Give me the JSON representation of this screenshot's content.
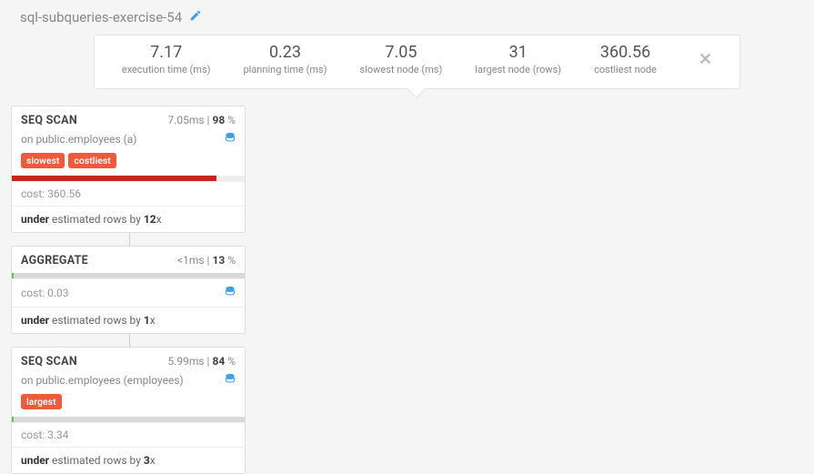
{
  "title": "sql-subqueries-exercise-54",
  "stats": {
    "execution": {
      "value": "7.17",
      "label": "execution time (ms)"
    },
    "planning": {
      "value": "0.23",
      "label": "planning time (ms)"
    },
    "slowest": {
      "value": "7.05",
      "label": "slowest node (ms)"
    },
    "largest": {
      "value": "31",
      "label": "largest node (rows)"
    },
    "costliest": {
      "value": "360.56",
      "label": "costliest node"
    }
  },
  "nodes": {
    "n0": {
      "title": "SEQ SCAN",
      "time": "7.05ms",
      "pct": "98",
      "sub": "on public.employees (a)",
      "tags": [
        "slowest",
        "costliest"
      ],
      "cost": "cost: 360.56",
      "est_prefix": "under",
      "est_mid": " estimated rows by ",
      "est_factor": "12",
      "est_suffix": "x"
    },
    "n1": {
      "title": "AGGREGATE",
      "time": "<1ms",
      "pct": "13",
      "cost": "cost: 0.03",
      "est_prefix": "under",
      "est_mid": " estimated rows by ",
      "est_factor": "1",
      "est_suffix": "x"
    },
    "n2": {
      "title": "SEQ SCAN",
      "time": "5.99ms",
      "pct": "84",
      "sub": "on public.employees (employees)",
      "tags": [
        "largest"
      ],
      "cost": "cost: 3.34",
      "est_prefix": "under",
      "est_mid": " estimated rows by ",
      "est_factor": "3",
      "est_suffix": "x"
    }
  }
}
